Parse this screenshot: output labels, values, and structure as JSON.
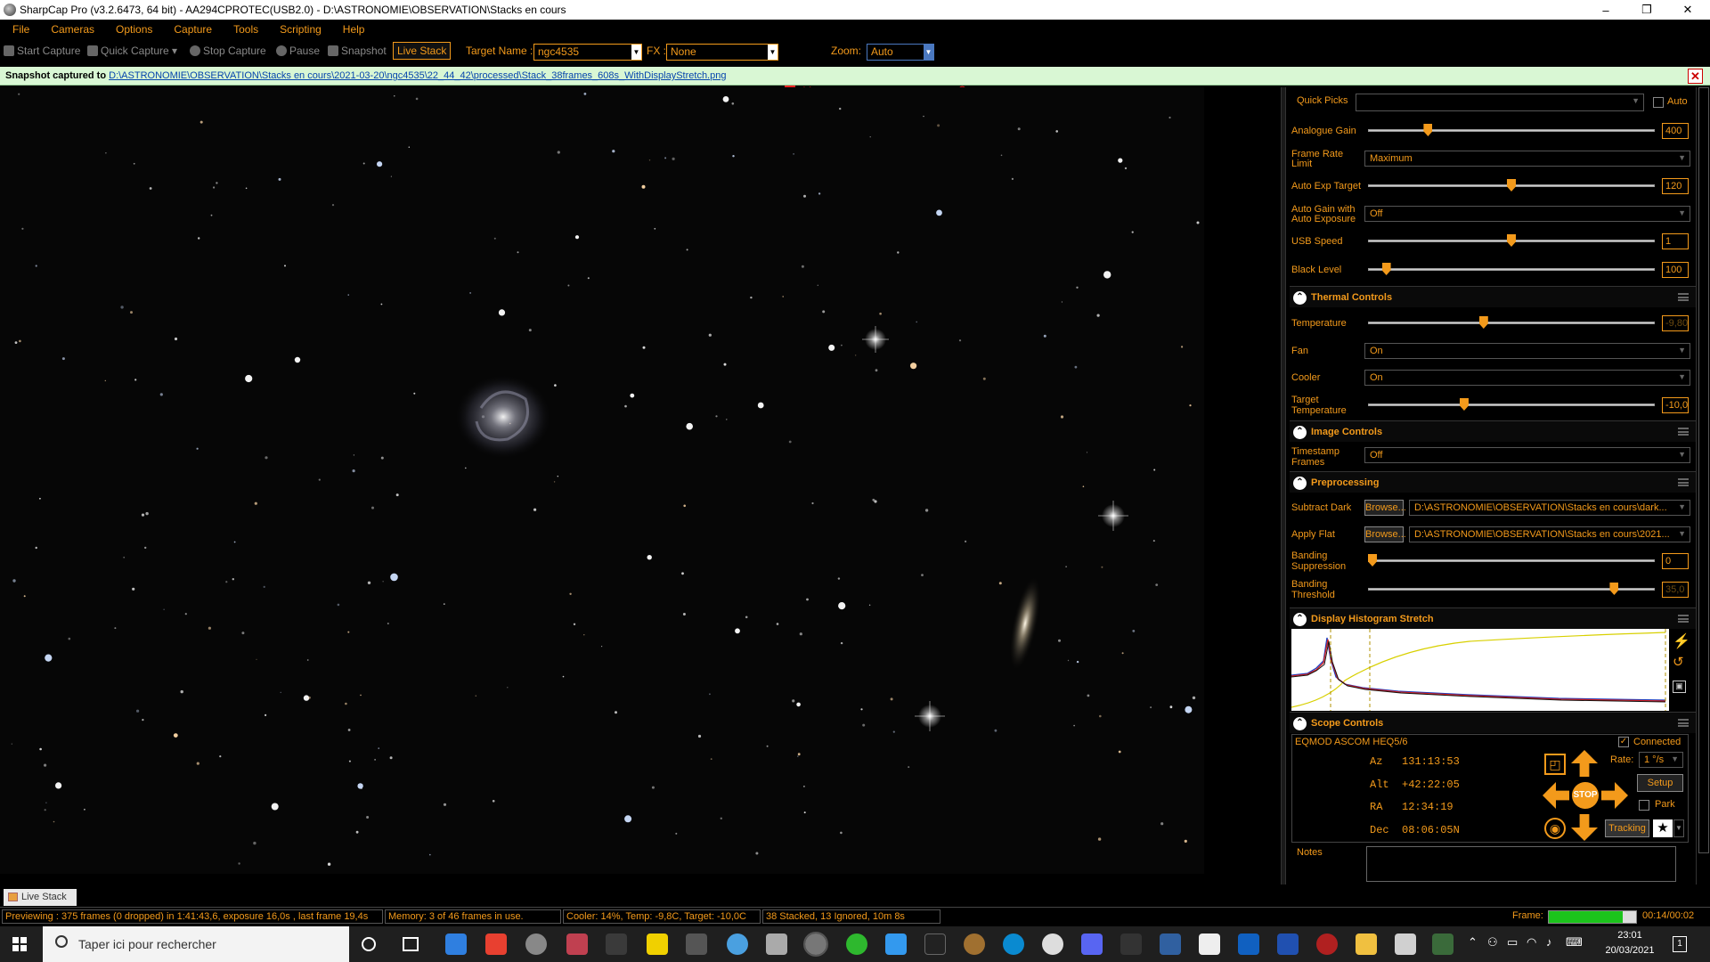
{
  "window": {
    "title": "SharpCap Pro (v3.2.6473, 64 bit) - AA294CPROTEC(USB2.0) - D:\\ASTRONOMIE\\OBSERVATION\\Stacks en cours",
    "minimize": "–",
    "restore": "❐",
    "close": "✕"
  },
  "menu": [
    "File",
    "Cameras",
    "Options",
    "Capture",
    "Tools",
    "Scripting",
    "Help"
  ],
  "toolbar": {
    "start_capture": "Start Capture",
    "quick_capture": "Quick Capture",
    "stop_capture": "Stop Capture",
    "pause": "Pause",
    "snapshot": "Snapshot",
    "live_stack": "Live Stack",
    "target_name_label": "Target Name :",
    "target_name_value": "ngc4535",
    "fx_label": "FX :",
    "fx_value": "None",
    "zoom_label": "Zoom:",
    "zoom_value": "Auto"
  },
  "notification": {
    "prefix": "Snapshot captured to ",
    "path": "D:\\ASTRONOMIE\\OBSERVATION\\Stacks en cours\\2021-03-20\\ngc4535\\22_44_42\\processed\\Stack_38frames_608s_WithDisplayStretch.png",
    "close": "✕"
  },
  "camera_controls": {
    "quick_picks_label": "Quick Picks",
    "quick_picks_value": "",
    "auto_label": "Auto",
    "analogue_gain": {
      "label": "Analogue Gain",
      "value": "400",
      "fraction": 0.2
    },
    "frame_rate_limit": {
      "label1": "Frame Rate",
      "label2": "Limit",
      "value": "Maximum"
    },
    "auto_exp_target": {
      "label": "Auto Exp Target",
      "value": "120",
      "fraction": 0.5
    },
    "auto_gain": {
      "label1": "Auto Gain with",
      "label2": "Auto Exposure",
      "value": "Off"
    },
    "usb_speed": {
      "label": "USB Speed",
      "value": "1",
      "fraction": 0.5
    },
    "black_level": {
      "label": "Black Level",
      "value": "100",
      "fraction": 0.05
    }
  },
  "thermal": {
    "header": "Thermal Controls",
    "temperature": {
      "label": "Temperature",
      "value": "-9,80",
      "fraction": 0.4
    },
    "fan": {
      "label": "Fan",
      "value": "On"
    },
    "cooler": {
      "label": "Cooler",
      "value": "On"
    },
    "target_temperature": {
      "label1": "Target",
      "label2": "Temperature",
      "value": "-10,0",
      "fraction": 0.33
    }
  },
  "image_controls": {
    "header": "Image Controls",
    "timestamp": {
      "label1": "Timestamp",
      "label2": "Frames",
      "value": "Off"
    }
  },
  "preprocessing": {
    "header": "Preprocessing",
    "subtract_dark": {
      "label": "Subtract Dark",
      "browse": "Browse...",
      "value": "D:\\ASTRONOMIE\\OBSERVATION\\Stacks en cours\\dark..."
    },
    "apply_flat": {
      "label": "Apply Flat",
      "browse": "Browse...",
      "value": "D:\\ASTRONOMIE\\OBSERVATION\\Stacks en cours\\2021..."
    },
    "banding_suppression": {
      "label1": "Banding",
      "label2": "Suppression",
      "value": "0",
      "fraction": 0.0
    },
    "banding_threshold": {
      "label1": "Banding",
      "label2": "Threshold",
      "value": "35,0",
      "fraction": 0.87
    }
  },
  "histogram": {
    "header": "Display Histogram Stretch"
  },
  "scope": {
    "header": "Scope Controls",
    "mount": "EQMOD ASCOM HEQ5/6",
    "connected_label": "Connected",
    "az": "Az   131:13:53",
    "alt": "Alt  +42:22:05",
    "ra": "RA   12:34:19",
    "dec": "Dec  08:06:05N",
    "rate_label": "Rate:",
    "rate_value": "1 °/s",
    "setup": "Setup",
    "park": "Park",
    "tracking": "Tracking",
    "stop": "STOP"
  },
  "notes_label": "Notes",
  "bottom_tab": "Live Stack",
  "status": {
    "previewing": "Previewing : 375 frames (0 dropped) in 1:41:43,6, exposure 16,0s , last frame 19,4s",
    "memory": "Memory: 3 of 46 frames in use.",
    "cooler": "Cooler: 14%, Temp: -9,8C, Target: -10,0C",
    "stacked": "38 Stacked, 13 Ignored, 10m 8s",
    "frame_label": "Frame:",
    "frame_time": "00:14/00:02",
    "frame_progress": 0.85
  },
  "taskbar": {
    "search_placeholder": "Taper ici pour rechercher",
    "time": "23:01",
    "date": "20/03/2021",
    "notifications": "1"
  },
  "colors": {
    "accent": "#f39a1b",
    "notification_bg": "#d9f7d4"
  }
}
